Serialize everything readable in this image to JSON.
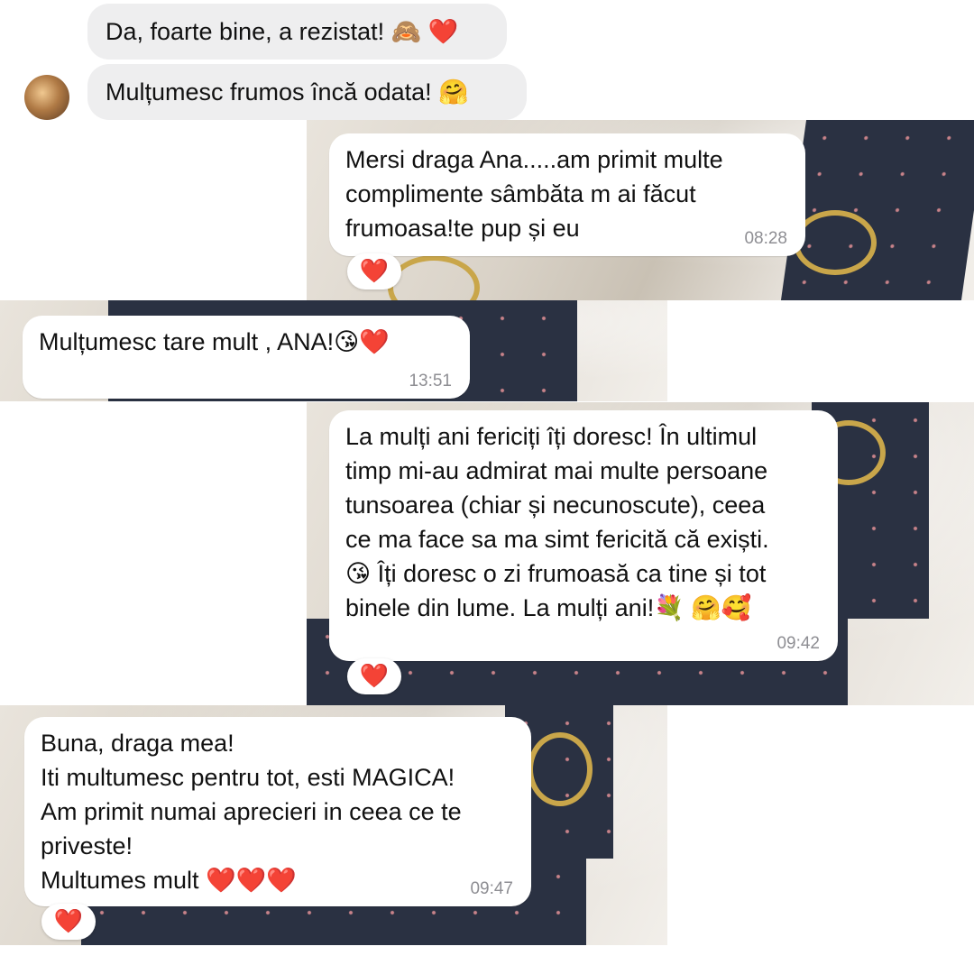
{
  "messages": [
    {
      "id": "m1",
      "direction": "incoming",
      "style": "grey",
      "text": "Da, foarte bine, a rezistat! 🙈",
      "emoji_after": "❤️"
    },
    {
      "id": "m2",
      "direction": "incoming",
      "style": "grey",
      "text": "Mulțumesc frumos încă odata! 🤗"
    },
    {
      "id": "m3",
      "direction": "incoming",
      "style": "white",
      "text": "Mersi draga Ana.....am primit multe\ncomplimente sâmbăta m ai făcut\nfrumoasa!te pup și eu",
      "time": "08:28",
      "reaction": "❤️"
    },
    {
      "id": "m4",
      "direction": "incoming",
      "style": "white",
      "text": "Mulțumesc tare mult , ANA!😘❤️",
      "time": "13:51"
    },
    {
      "id": "m5",
      "direction": "incoming",
      "style": "white",
      "text": "La mulți ani fericiți îți doresc!  În ultimul\ntimp mi-au admirat mai multe persoane\ntunsoarea (chiar și necunoscute), ceea\nce ma face sa ma simt fericită că exiști.\n😘 Îți doresc o zi frumoasă ca tine și tot\nbinele din lume. La mulți ani!💐 🤗🥰",
      "time": "09:42",
      "reaction": "❤️"
    },
    {
      "id": "m6",
      "direction": "incoming",
      "style": "white",
      "text": "Buna, draga mea!\nIti multumesc pentru tot, esti MAGICA!\nAm primit numai aprecieri in ceea ce te\npriveste!\nMultumes mult ❤️❤️❤️",
      "time": "09:47",
      "reaction": "❤️"
    }
  ],
  "colors": {
    "bubble_grey": "#eeeeef",
    "bubble_white": "#ffffff",
    "timestamp": "#8e8e93",
    "heart": "#e0242f",
    "strap": "#2a3142",
    "buckle": "#c9a64a"
  },
  "icons": {
    "avatar": "contact-avatar",
    "reaction": "heart-icon"
  }
}
